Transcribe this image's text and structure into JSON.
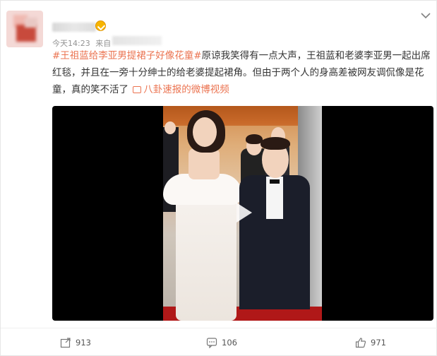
{
  "post": {
    "timestamp": "今天14:23",
    "source_prefix": "来自",
    "topic": "#王祖蓝给李亚男提裙子好像花童#",
    "text_after_topic": "原谅我笑得有一点大声，王祖蓝和老婆李亚男一起出席红毯，并且在一旁十分绅士的给老婆提起裙角。但由于两个人的身高差被网友调侃像是花童，真的笑不活了",
    "video_link": "八卦速报的微博视频"
  },
  "actions": {
    "repost_count": "913",
    "comment_count": "106",
    "like_count": "971"
  },
  "icons": {
    "more": "chevron-down-icon",
    "repost": "share-icon",
    "comment": "comment-icon",
    "like": "thumbs-up-icon",
    "play": "play-icon",
    "video_link": "video-icon",
    "badge": "vip-badge-icon"
  },
  "colors": {
    "topic": "#eb7350",
    "meta": "#939393",
    "text": "#333333",
    "video_bg": "#000000"
  }
}
